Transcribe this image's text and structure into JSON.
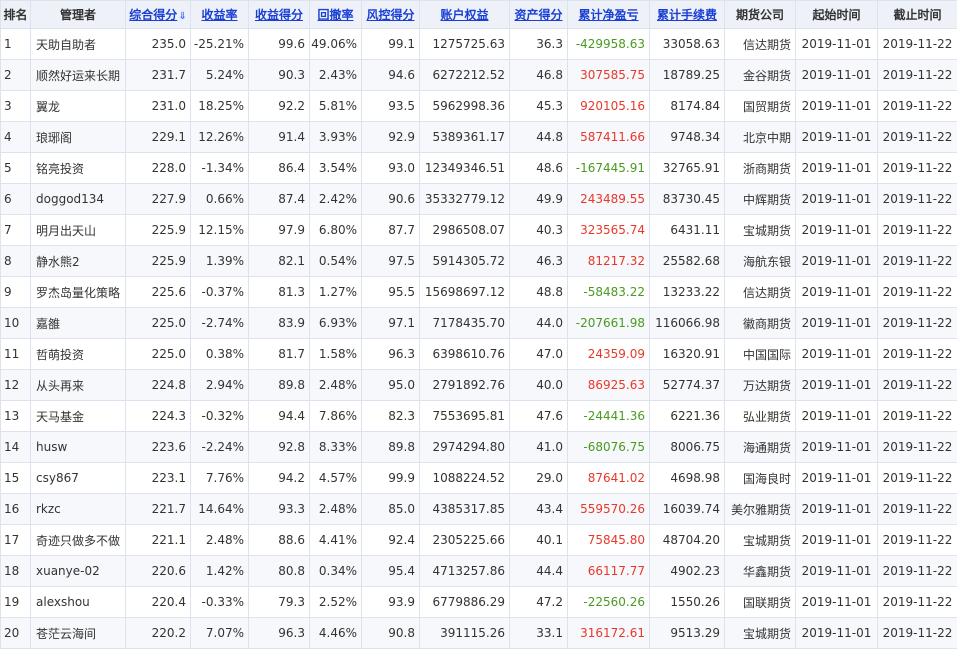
{
  "headers": {
    "rank": "排名",
    "manager": "管理者",
    "score": "综合得分",
    "return_rate": "收益率",
    "return_score": "收益得分",
    "drawdown": "回撤率",
    "risk_score": "风控得分",
    "equity": "账户权益",
    "asset_score": "资产得分",
    "cum_pnl": "累计净盈亏",
    "cum_fee": "累计手续费",
    "broker": "期货公司",
    "start_time": "起始时间",
    "end_time": "截止时间"
  },
  "sort_arrow": "⇓",
  "rows": [
    {
      "rank": "1",
      "manager": "天助自助者",
      "score": "235.0",
      "return_rate": "-25.21%",
      "return_score": "99.6",
      "drawdown": "49.06%",
      "risk_score": "99.1",
      "equity": "1275725.63",
      "asset_score": "36.3",
      "cum_pnl": "-429958.63",
      "pnl_sign": "neg",
      "cum_fee": "33058.63",
      "broker": "信达期货",
      "start_time": "2019-11-01",
      "end_time": "2019-11-22"
    },
    {
      "rank": "2",
      "manager": "顺然好运来长期",
      "score": "231.7",
      "return_rate": "5.24%",
      "return_score": "90.3",
      "drawdown": "2.43%",
      "risk_score": "94.6",
      "equity": "6272212.52",
      "asset_score": "46.8",
      "cum_pnl": "307585.75",
      "pnl_sign": "pos",
      "cum_fee": "18789.25",
      "broker": "金谷期货",
      "start_time": "2019-11-01",
      "end_time": "2019-11-22"
    },
    {
      "rank": "3",
      "manager": "翼龙",
      "score": "231.0",
      "return_rate": "18.25%",
      "return_score": "92.2",
      "drawdown": "5.81%",
      "risk_score": "93.5",
      "equity": "5962998.36",
      "asset_score": "45.3",
      "cum_pnl": "920105.16",
      "pnl_sign": "pos",
      "cum_fee": "8174.84",
      "broker": "国贸期货",
      "start_time": "2019-11-01",
      "end_time": "2019-11-22"
    },
    {
      "rank": "4",
      "manager": "琅琊阁",
      "score": "229.1",
      "return_rate": "12.26%",
      "return_score": "91.4",
      "drawdown": "3.93%",
      "risk_score": "92.9",
      "equity": "5389361.17",
      "asset_score": "44.8",
      "cum_pnl": "587411.66",
      "pnl_sign": "pos",
      "cum_fee": "9748.34",
      "broker": "北京中期",
      "start_time": "2019-11-01",
      "end_time": "2019-11-22"
    },
    {
      "rank": "5",
      "manager": "铭亮投资",
      "score": "228.0",
      "return_rate": "-1.34%",
      "return_score": "86.4",
      "drawdown": "3.54%",
      "risk_score": "93.0",
      "equity": "12349346.51",
      "asset_score": "48.6",
      "cum_pnl": "-167445.91",
      "pnl_sign": "neg",
      "cum_fee": "32765.91",
      "broker": "浙商期货",
      "start_time": "2019-11-01",
      "end_time": "2019-11-22"
    },
    {
      "rank": "6",
      "manager": "doggod134",
      "score": "227.9",
      "return_rate": "0.66%",
      "return_score": "87.4",
      "drawdown": "2.42%",
      "risk_score": "90.6",
      "equity": "35332779.12",
      "asset_score": "49.9",
      "cum_pnl": "243489.55",
      "pnl_sign": "pos",
      "cum_fee": "83730.45",
      "broker": "中辉期货",
      "start_time": "2019-11-01",
      "end_time": "2019-11-22"
    },
    {
      "rank": "7",
      "manager": "明月出天山",
      "score": "225.9",
      "return_rate": "12.15%",
      "return_score": "97.9",
      "drawdown": "6.80%",
      "risk_score": "87.7",
      "equity": "2986508.07",
      "asset_score": "40.3",
      "cum_pnl": "323565.74",
      "pnl_sign": "pos",
      "cum_fee": "6431.11",
      "broker": "宝城期货",
      "start_time": "2019-11-01",
      "end_time": "2019-11-22"
    },
    {
      "rank": "8",
      "manager": "静水熊2",
      "score": "225.9",
      "return_rate": "1.39%",
      "return_score": "82.1",
      "drawdown": "0.54%",
      "risk_score": "97.5",
      "equity": "5914305.72",
      "asset_score": "46.3",
      "cum_pnl": "81217.32",
      "pnl_sign": "pos",
      "cum_fee": "25582.68",
      "broker": "海航东银",
      "start_time": "2019-11-01",
      "end_time": "2019-11-22"
    },
    {
      "rank": "9",
      "manager": "罗杰岛量化策略",
      "score": "225.6",
      "return_rate": "-0.37%",
      "return_score": "81.3",
      "drawdown": "1.27%",
      "risk_score": "95.5",
      "equity": "15698697.12",
      "asset_score": "48.8",
      "cum_pnl": "-58483.22",
      "pnl_sign": "neg",
      "cum_fee": "13233.22",
      "broker": "信达期货",
      "start_time": "2019-11-01",
      "end_time": "2019-11-22"
    },
    {
      "rank": "10",
      "manager": "嘉雒",
      "score": "225.0",
      "return_rate": "-2.74%",
      "return_score": "83.9",
      "drawdown": "6.93%",
      "risk_score": "97.1",
      "equity": "7178435.70",
      "asset_score": "44.0",
      "cum_pnl": "-207661.98",
      "pnl_sign": "neg",
      "cum_fee": "116066.98",
      "broker": "徽商期货",
      "start_time": "2019-11-01",
      "end_time": "2019-11-22"
    },
    {
      "rank": "11",
      "manager": "哲萌投资",
      "score": "225.0",
      "return_rate": "0.38%",
      "return_score": "81.7",
      "drawdown": "1.58%",
      "risk_score": "96.3",
      "equity": "6398610.76",
      "asset_score": "47.0",
      "cum_pnl": "24359.09",
      "pnl_sign": "pos",
      "cum_fee": "16320.91",
      "broker": "中国国际",
      "start_time": "2019-11-01",
      "end_time": "2019-11-22"
    },
    {
      "rank": "12",
      "manager": "从头再来",
      "score": "224.8",
      "return_rate": "2.94%",
      "return_score": "89.8",
      "drawdown": "2.48%",
      "risk_score": "95.0",
      "equity": "2791892.76",
      "asset_score": "40.0",
      "cum_pnl": "86925.63",
      "pnl_sign": "pos",
      "cum_fee": "52774.37",
      "broker": "万达期货",
      "start_time": "2019-11-01",
      "end_time": "2019-11-22"
    },
    {
      "rank": "13",
      "manager": "天马基金",
      "score": "224.3",
      "return_rate": "-0.32%",
      "return_score": "94.4",
      "drawdown": "7.86%",
      "risk_score": "82.3",
      "equity": "7553695.81",
      "asset_score": "47.6",
      "cum_pnl": "-24441.36",
      "pnl_sign": "neg",
      "cum_fee": "6221.36",
      "broker": "弘业期货",
      "start_time": "2019-11-01",
      "end_time": "2019-11-22"
    },
    {
      "rank": "14",
      "manager": "husw",
      "score": "223.6",
      "return_rate": "-2.24%",
      "return_score": "92.8",
      "drawdown": "8.33%",
      "risk_score": "89.8",
      "equity": "2974294.80",
      "asset_score": "41.0",
      "cum_pnl": "-68076.75",
      "pnl_sign": "neg",
      "cum_fee": "8006.75",
      "broker": "海通期货",
      "start_time": "2019-11-01",
      "end_time": "2019-11-22"
    },
    {
      "rank": "15",
      "manager": "csy867",
      "score": "223.1",
      "return_rate": "7.76%",
      "return_score": "94.2",
      "drawdown": "4.57%",
      "risk_score": "99.9",
      "equity": "1088224.52",
      "asset_score": "29.0",
      "cum_pnl": "87641.02",
      "pnl_sign": "pos",
      "cum_fee": "4698.98",
      "broker": "国海良时",
      "start_time": "2019-11-01",
      "end_time": "2019-11-22"
    },
    {
      "rank": "16",
      "manager": "rkzc",
      "score": "221.7",
      "return_rate": "14.64%",
      "return_score": "93.3",
      "drawdown": "2.48%",
      "risk_score": "85.0",
      "equity": "4385317.85",
      "asset_score": "43.4",
      "cum_pnl": "559570.26",
      "pnl_sign": "pos",
      "cum_fee": "16039.74",
      "broker": "美尔雅期货",
      "start_time": "2019-11-01",
      "end_time": "2019-11-22"
    },
    {
      "rank": "17",
      "manager": "奇迹只做多不做",
      "score": "221.1",
      "return_rate": "2.48%",
      "return_score": "88.6",
      "drawdown": "4.41%",
      "risk_score": "92.4",
      "equity": "2305225.66",
      "asset_score": "40.1",
      "cum_pnl": "75845.80",
      "pnl_sign": "pos",
      "cum_fee": "48704.20",
      "broker": "宝城期货",
      "start_time": "2019-11-01",
      "end_time": "2019-11-22"
    },
    {
      "rank": "18",
      "manager": "xuanye-02",
      "score": "220.6",
      "return_rate": "1.42%",
      "return_score": "80.8",
      "drawdown": "0.34%",
      "risk_score": "95.4",
      "equity": "4713257.86",
      "asset_score": "44.4",
      "cum_pnl": "66117.77",
      "pnl_sign": "pos",
      "cum_fee": "4902.23",
      "broker": "华鑫期货",
      "start_time": "2019-11-01",
      "end_time": "2019-11-22"
    },
    {
      "rank": "19",
      "manager": "alexshou",
      "score": "220.4",
      "return_rate": "-0.33%",
      "return_score": "79.3",
      "drawdown": "2.52%",
      "risk_score": "93.9",
      "equity": "6779886.29",
      "asset_score": "47.2",
      "cum_pnl": "-22560.26",
      "pnl_sign": "neg",
      "cum_fee": "1550.26",
      "broker": "国联期货",
      "start_time": "2019-11-01",
      "end_time": "2019-11-22"
    },
    {
      "rank": "20",
      "manager": "苍茫云海间",
      "score": "220.2",
      "return_rate": "7.07%",
      "return_score": "96.3",
      "drawdown": "4.46%",
      "risk_score": "90.8",
      "equity": "391115.26",
      "asset_score": "33.1",
      "cum_pnl": "316172.61",
      "pnl_sign": "pos",
      "cum_fee": "9513.29",
      "broker": "宝城期货",
      "start_time": "2019-11-01",
      "end_time": "2019-11-22"
    }
  ],
  "colors": {
    "header_bg": "#eef2f8",
    "link_header": "#1a3fd6",
    "positive": "#e8382a",
    "negative": "#4a9a1f",
    "border": "#dde3ee"
  }
}
